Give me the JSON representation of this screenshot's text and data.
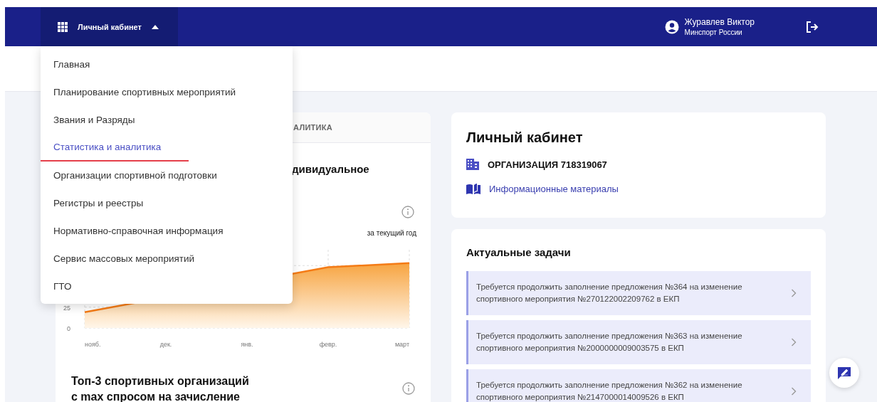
{
  "header": {
    "menu_button": {
      "label": "Личный кабинет",
      "expanded": true
    },
    "user": {
      "name": "Журавлев Виктор",
      "organization": "Минспорт России"
    }
  },
  "nav_menu": {
    "items": [
      {
        "label": "Главная",
        "selected": false
      },
      {
        "label": "Планирование спортивных мероприятий",
        "selected": false
      },
      {
        "label": "Звания и Разряды",
        "selected": false
      },
      {
        "label": "Статистика и аналитика",
        "selected": true
      },
      {
        "label": "Организации спортивной подготовки",
        "selected": false
      },
      {
        "label": "Регистры и реестры",
        "selected": false
      },
      {
        "label": "Нормативно-справочная информация",
        "selected": false
      },
      {
        "label": "Сервис массовых мероприятий",
        "selected": false
      },
      {
        "label": "ГТО",
        "selected": false
      }
    ]
  },
  "analytics_card": {
    "tab_label": "АЛИТИКА",
    "chart_title": "дивидуальное",
    "period": "за текущий год",
    "chart_data": {
      "type": "area",
      "categories": [
        "нояб.",
        "дек.",
        "янв.",
        "февр.",
        "март"
      ],
      "series": [
        {
          "color": "#f47b16",
          "values": [
            19,
            null,
            null,
            73,
            78
          ]
        }
      ],
      "ylim": [
        0,
        94
      ],
      "yticks": [
        0,
        25
      ]
    },
    "top_title": [
      "Топ-3 спортивных организаций",
      "с max спросом на зачисление"
    ]
  },
  "account_card": {
    "title": "Личный кабинет",
    "organization": "ОРГАНИЗАЦИЯ 718319067",
    "info_link": "Информационные материалы"
  },
  "tasks_card": {
    "title": "Актуальные задачи",
    "tasks": [
      {
        "text": "Требуется продолжить заполнение предложения №364 на изменение спортивного мероприятия №270122002209762 в ЕКП"
      },
      {
        "text": "Требуется продолжить заполнение предложения №363 на изменение спортивного мероприятия №2000000009003575 в ЕКП"
      },
      {
        "text": "Требуется продолжить заполнение предложения №362 на изменение спортивного мероприятия №2147000014009526 в ЕКП"
      }
    ]
  }
}
